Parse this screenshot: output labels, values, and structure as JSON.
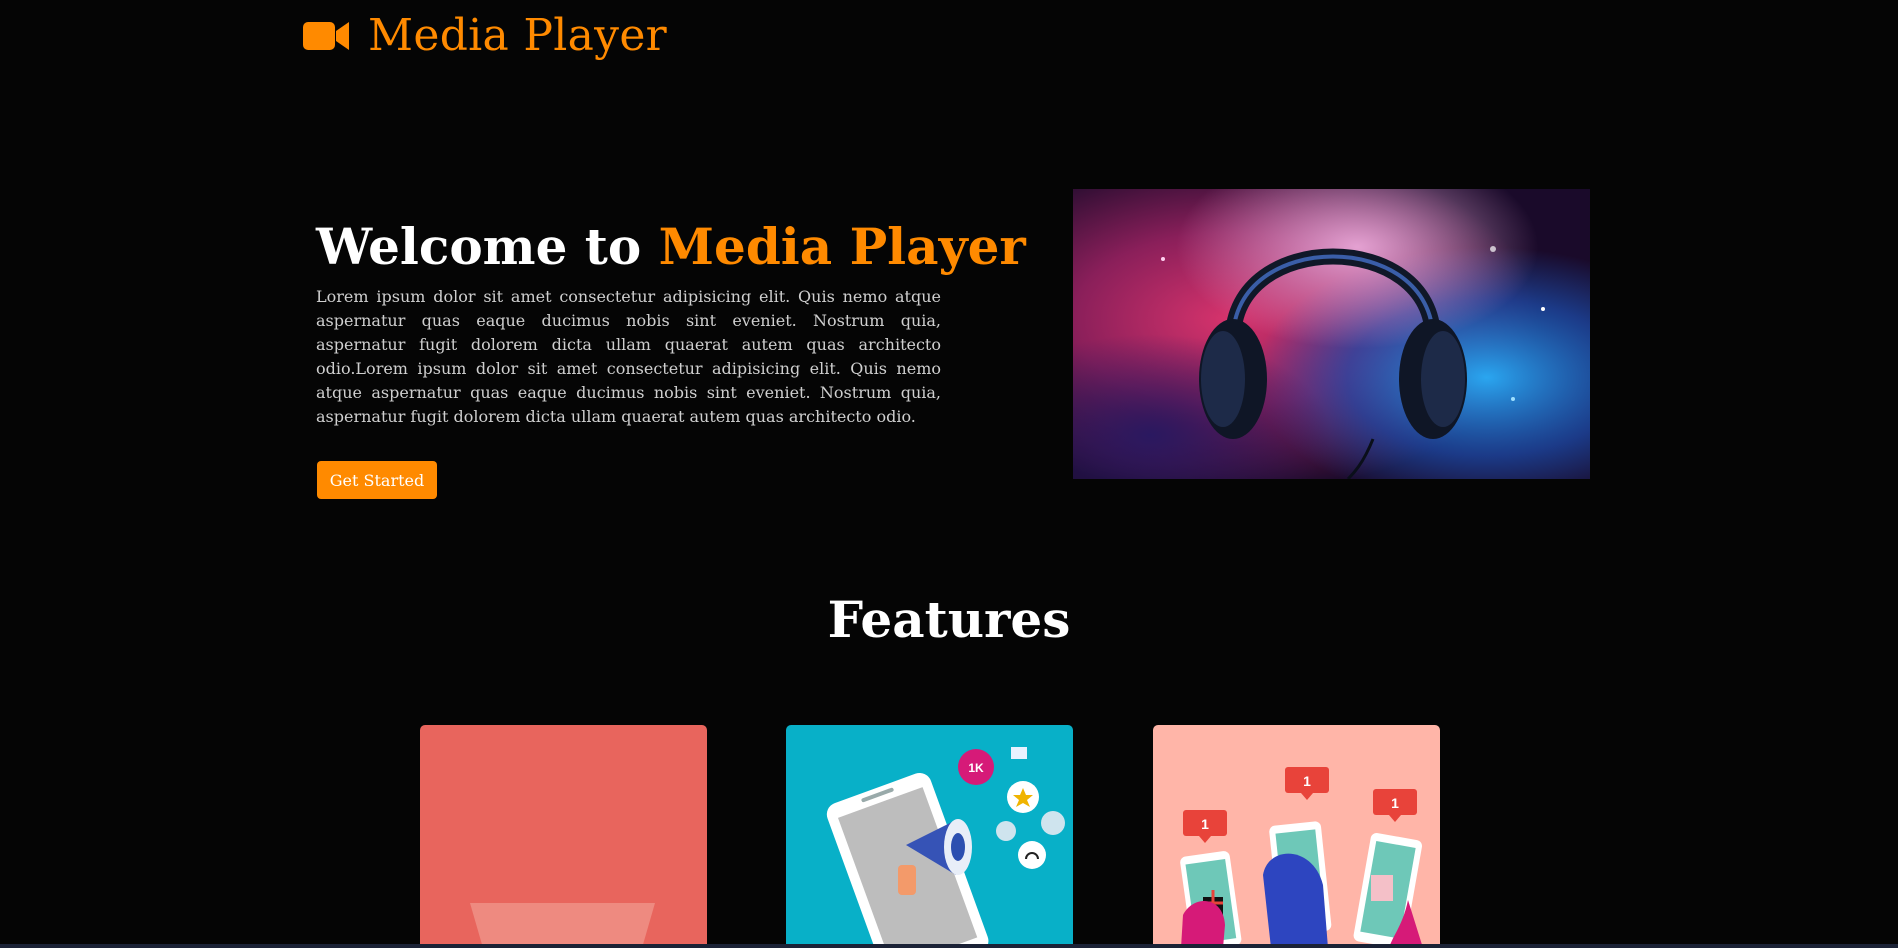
{
  "header": {
    "brand_name": "Media Player",
    "logo_icon": "video-camera-icon",
    "accent_color": "#ff8a00"
  },
  "hero": {
    "title_prefix": "Welcome to ",
    "title_accent": "Media Player",
    "description": "Lorem ipsum dolor sit amet consectetur adipisicing elit. Quis nemo atque aspernatur quas eaque ducimus nobis sint eveniet. Nostrum quia, aspernatur fugit dolorem dicta ullam quaerat autem quas architecto odio.Lorem ipsum dolor sit amet consectetur adipisicing elit. Quis nemo atque aspernatur quas eaque ducimus nobis sint eveniet. Nostrum quia, aspernatur fugit dolorem dicta ullam quaerat autem quas architecto odio.",
    "cta_label": "Get Started",
    "image_icon": "headphones-icon"
  },
  "features": {
    "title": "Features",
    "cards": [
      {
        "illustration": "video-player-icon",
        "color": "#e8655d"
      },
      {
        "illustration": "megaphone-phone-icon",
        "color": "#08b0c8"
      },
      {
        "illustration": "social-likes-icon",
        "color": "#ffb5a8"
      }
    ],
    "badges": [
      "1K",
      "1",
      "1",
      "1"
    ]
  }
}
